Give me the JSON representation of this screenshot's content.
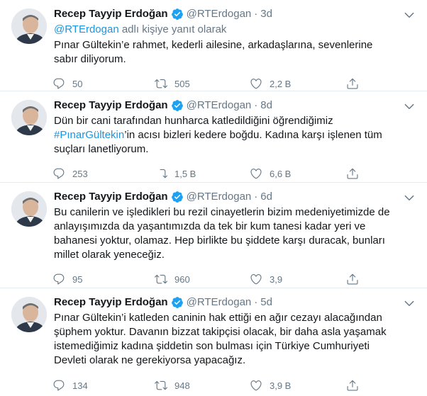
{
  "tweets": [
    {
      "name": "Recep Tayyip Erdoğan",
      "handle": "@RTErdogan",
      "dot": "·",
      "time": "3d",
      "reply_handle": "@RTErdogan",
      "reply_suffix": " adlı kişiye yanıt olarak",
      "text_before": "Pınar Gültekin’e rahmet, kederli ailesine, arkadaşlarına, sevenlerine sabır diliyorum.",
      "hashtag": "",
      "text_after": "",
      "replies": "50",
      "retweets": "505",
      "likes": "2,2 B"
    },
    {
      "name": "Recep Tayyip Erdoğan",
      "handle": "@RTErdogan",
      "dot": "·",
      "time": "8d",
      "text_before": "Dün bir cani tarafından hunharca katledildiğini öğrendiğimiz ",
      "hashtag": "#PınarGültekin",
      "text_after": "’in acısı bizleri kedere boğdu. Kadına karşı işlenen tüm suçları lanetliyorum.",
      "replies": "253",
      "retweets": "1,5 B",
      "likes": "6,6 B"
    },
    {
      "name": "Recep Tayyip Erdoğan",
      "handle": "@RTErdogan",
      "dot": "·",
      "time": "6d",
      "text_before": "Bu canilerin ve işledikleri bu rezil cinayetlerin bizim medeniyetimizde de anlayışımızda da yaşantımızda da tek bir kum tanesi kadar yeri ve bahanesi yoktur, olamaz. Hep birlikte bu şiddete karşı duracak, bunları millet olarak yeneceğiz.",
      "hashtag": "",
      "text_after": "",
      "replies": "95",
      "retweets": "960",
      "likes": "3,9"
    },
    {
      "name": "Recep Tayyip Erdoğan",
      "handle": "@RTErdogan",
      "dot": "·",
      "time": "5d",
      "text_before": "Pınar Gültekin’i katleden caninin hak ettiği en ağır cezayı alacağından şüphem yoktur. Davanın bizzat takipçisi olacak, bir daha asla yaşamak istemediğimiz kadına şiddetin son bulması için Türkiye Cumhuriyeti Devleti olarak ne gerekiyorsa yapacağız.",
      "hashtag": "",
      "text_after": "",
      "replies": "134",
      "retweets": "948",
      "likes": "3,9 B"
    }
  ],
  "icons": {
    "verified": "verified-badge-icon",
    "menu": "chevron-down-icon",
    "reply": "reply-icon",
    "retweet": "retweet-icon",
    "like": "heart-icon",
    "share": "share-icon"
  },
  "colors": {
    "link": "#1b95e0",
    "muted": "#657786",
    "divider": "#e6ecf0",
    "text": "#14171a"
  }
}
